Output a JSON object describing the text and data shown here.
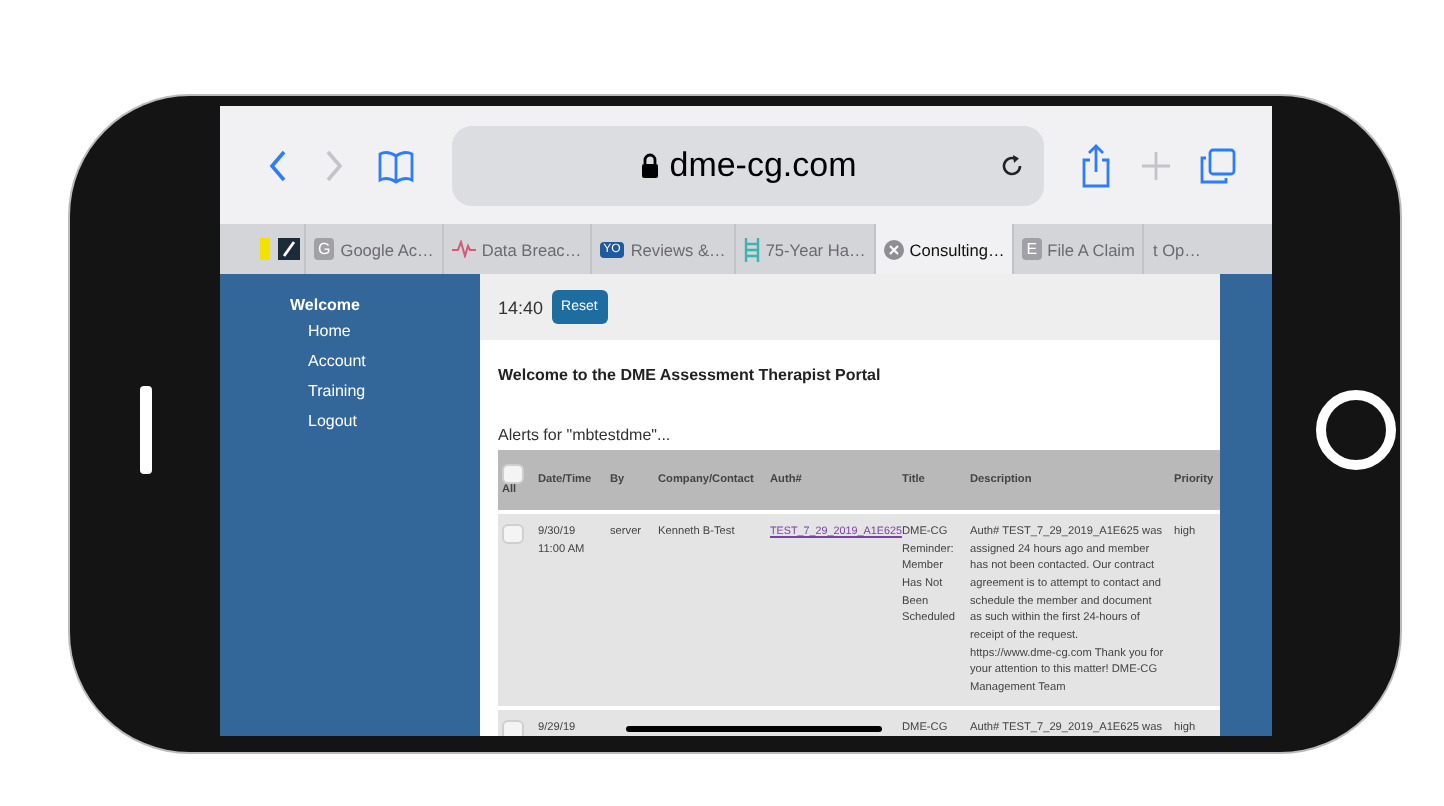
{
  "browser": {
    "url": "dme-cg.com"
  },
  "tabs": [
    {
      "kind": "square",
      "selected": false
    },
    {
      "kind": "slash",
      "selected": false
    },
    {
      "label": "Google Ac…",
      "kind": "letter",
      "badge": "G",
      "selected": false
    },
    {
      "label": "Data Breac…",
      "kind": "wave",
      "selected": false
    },
    {
      "label": "Reviews &…",
      "kind": "letter",
      "badge": "YO",
      "selected": false
    },
    {
      "label": "75-Year Ha…",
      "kind": "ladder",
      "selected": false
    },
    {
      "label": "Consulting…",
      "kind": "close",
      "selected": true
    },
    {
      "label": "File A Claim",
      "kind": "letter",
      "badge": "E",
      "selected": false
    },
    {
      "label": "t Op…",
      "kind": "plain",
      "selected": false
    }
  ],
  "sidebar": {
    "heading": "Welcome",
    "items": [
      "Home",
      "Account",
      "Training",
      "Logout"
    ]
  },
  "header": {
    "time": "14:40",
    "button": "Reset"
  },
  "welcome": "Welcome to the DME Assessment Therapist Portal",
  "alerts_label": "Alerts for \"mbtestdme\"...",
  "table": {
    "select_all": "All",
    "select_all_checked": false,
    "columns": [
      "Date/Time",
      "By",
      "Company/Contact",
      "Auth#",
      "Title",
      "Description",
      "Priority"
    ],
    "rows": [
      {
        "checked": false,
        "redacted": false,
        "date": "9/30/19",
        "time": "11:00 AM",
        "by": "server",
        "company": "Kenneth B-Test",
        "auth": "TEST_7_29_2019_A1E625",
        "title": "DME-CG Reminder: Member Has Not Been Scheduled",
        "description": "Auth# TEST_7_29_2019_A1E625 was assigned 24 hours ago and member has not been contacted. Our contract agreement is to attempt to contact and schedule the member and document as such within the first 24-hours of receipt of the request. https://www.dme-cg.com Thank you for your attention to this matter! DME-CG Management Team",
        "priority": "high"
      },
      {
        "checked": false,
        "redacted": true,
        "date": "9/29/19",
        "title": "DME-CG",
        "description": "Auth# TEST_7_29_2019_A1E625 was",
        "priority": "high"
      }
    ]
  }
}
